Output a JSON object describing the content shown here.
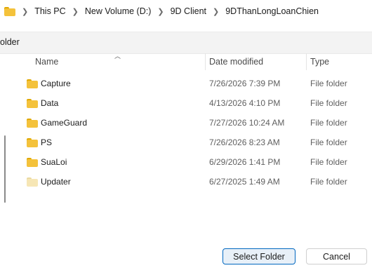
{
  "breadcrumb": [
    "This PC",
    "New Volume (D:)",
    "9D Client",
    "9DThanLongLoanChien"
  ],
  "command_bar": {
    "label": "older"
  },
  "columns": {
    "name": "Name",
    "date": "Date modified",
    "type": "Type"
  },
  "rows": [
    {
      "name": "Capture",
      "date": "7/26/2026 7:39 PM",
      "type": "File folder",
      "icon": "folder-icon"
    },
    {
      "name": "Data",
      "date": "4/13/2026 4:10 PM",
      "type": "File folder",
      "icon": "folder-icon"
    },
    {
      "name": "GameGuard",
      "date": "7/27/2026 10:24 AM",
      "type": "File folder",
      "icon": "folder-icon"
    },
    {
      "name": "PS",
      "date": "7/26/2026 8:23 AM",
      "type": "File folder",
      "icon": "folder-icon"
    },
    {
      "name": "SuaLoi",
      "date": "6/29/2026 1:41 PM",
      "type": "File folder",
      "icon": "folder-icon"
    },
    {
      "name": "Updater",
      "date": "6/27/2025 1:49 AM",
      "type": "File folder",
      "icon": "folder-icon-light"
    }
  ],
  "buttons": {
    "select": "Select Folder",
    "cancel": "Cancel"
  },
  "colors": {
    "accent": "#0067c0",
    "folder": "#f4c23b"
  }
}
